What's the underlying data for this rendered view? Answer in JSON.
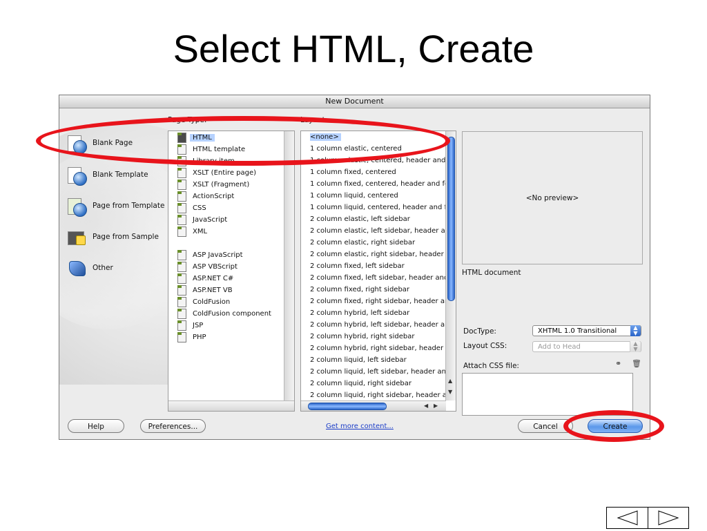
{
  "slide": {
    "title": "Select HTML, Create"
  },
  "dialog": {
    "title": "New Document",
    "categories": [
      {
        "label": "Blank Page",
        "icon": "blank-page-icon"
      },
      {
        "label": "Blank Template",
        "icon": "blank-template-icon"
      },
      {
        "label": "Page from Template",
        "icon": "page-from-template-icon"
      },
      {
        "label": "Page from Sample",
        "icon": "page-from-sample-icon"
      },
      {
        "label": "Other",
        "icon": "other-icon"
      }
    ],
    "page_type_label": "Page Type:",
    "page_types": [
      "HTML",
      "HTML template",
      "Library item",
      "XSLT (Entire page)",
      "XSLT (Fragment)",
      "ActionScript",
      "CSS",
      "JavaScript",
      "XML",
      "ASP JavaScript",
      "ASP VBScript",
      "ASP.NET C#",
      "ASP.NET VB",
      "ColdFusion",
      "ColdFusion component",
      "JSP",
      "PHP"
    ],
    "layout_label": "Layout:",
    "layouts": [
      "<none>",
      "1 column elastic, centered",
      "1 column elastic, centered, header and",
      "1 column fixed, centered",
      "1 column fixed, centered, header and fo",
      "1 column liquid, centered",
      "1 column liquid, centered, header and f",
      "2 column elastic, left sidebar",
      "2 column elastic, left sidebar, header ar",
      "2 column elastic, right sidebar",
      "2 column elastic, right sidebar, header a",
      "2 column fixed, left sidebar",
      "2 column fixed, left sidebar, header and",
      "2 column fixed, right sidebar",
      "2 column fixed, right sidebar, header ar",
      "2 column hybrid, left sidebar",
      "2 column hybrid, left sidebar, header ar",
      "2 column hybrid, right sidebar",
      "2 column hybrid, right sidebar, header a",
      "2 column liquid, left sidebar",
      "2 column liquid, left sidebar, header an",
      "2 column liquid, right sidebar",
      "2 column liquid, right sidebar, header a"
    ],
    "preview_text": "<No preview>",
    "description": "HTML document",
    "doctype_label": "DocType:",
    "doctype_value": "XHTML 1.0 Transitional",
    "layout_css_label": "Layout CSS:",
    "layout_css_value": "Add to Head",
    "attach_css_label": "Attach CSS file:",
    "buttons": {
      "help": "Help",
      "preferences": "Preferences...",
      "get_more": "Get more content...",
      "cancel": "Cancel",
      "create": "Create"
    }
  },
  "colors": {
    "highlight_oval": "#e8141b",
    "selection": "#b6d2ff",
    "aqua_blue": "#2a64c8"
  }
}
